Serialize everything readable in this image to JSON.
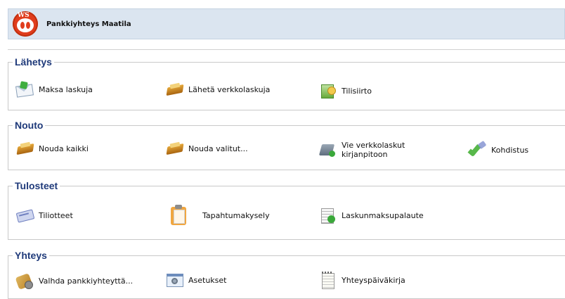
{
  "header": {
    "logo_text": "WS",
    "title": "Pankkiyhteys Maatila"
  },
  "groups": [
    {
      "title": "Lähetys",
      "items": [
        {
          "label": "Maksa laskuja",
          "icon": "envelope-pay-icon"
        },
        {
          "label": "Lähetä verkkolaskuja",
          "icon": "send-package-icon"
        },
        {
          "label": "Tilisiirto",
          "icon": "money-transfer-icon"
        }
      ]
    },
    {
      "title": "Nouto",
      "items": [
        {
          "label": "Nouda kaikki",
          "icon": "fetch-package-icon"
        },
        {
          "label": "Nouda valitut...",
          "icon": "fetch-selected-icon"
        },
        {
          "label_line1": "Vie verkkolaskut",
          "label_line2": "kirjanpitoon",
          "icon": "export-bookkeeping-icon"
        },
        {
          "label": "Kohdistus",
          "icon": "checkmark-icon"
        }
      ]
    },
    {
      "title": "Tulosteet",
      "items": [
        {
          "label": "Tiliotteet",
          "icon": "statement-icon"
        },
        {
          "label": "Tapahtumakysely",
          "icon": "clipboard-icon"
        },
        {
          "label": "Laskunmaksupalaute",
          "icon": "payment-feedback-icon"
        }
      ]
    },
    {
      "title": "Yhteys",
      "items": [
        {
          "label": "Valhda pankkiyhteyttä...",
          "icon": "change-connection-icon"
        },
        {
          "label": "Asetukset",
          "icon": "settings-icon"
        },
        {
          "label": "Yhteyspäiväkirja",
          "icon": "log-notepad-icon"
        }
      ]
    }
  ]
}
